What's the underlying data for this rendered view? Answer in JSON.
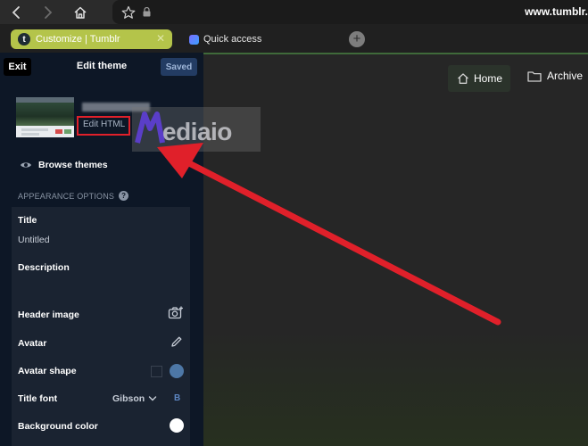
{
  "browser": {
    "url": "www.tumblr.",
    "tabs": [
      {
        "label": "Customize | Tumblr",
        "favicon": "t",
        "active": true
      },
      {
        "label": "Quick access",
        "active": false
      }
    ],
    "new_tab": "+"
  },
  "sidebar": {
    "exit_label": "Exit",
    "title": "Edit theme",
    "saved_label": "Saved",
    "edit_html_label": "Edit HTML",
    "browse_label": "Browse themes",
    "appearance_label": "APPEARANCE OPTIONS",
    "help": "?",
    "options": {
      "title_label": "Title",
      "title_value": "Untitled",
      "description_label": "Description",
      "header_image_label": "Header image",
      "avatar_label": "Avatar",
      "avatar_shape_label": "Avatar shape",
      "title_font_label": "Title font",
      "title_font_value": "Gibson",
      "title_font_bold": "B",
      "background_color_label": "Background color",
      "background_color_value": "#ffffff",
      "avatar_shape_color": "#4d77a6"
    }
  },
  "preview": {
    "nav": [
      {
        "label": "Home",
        "icon": "home-icon"
      },
      {
        "label": "Archive",
        "icon": "folder-icon"
      }
    ]
  },
  "overlay": {
    "watermark": "ediaio",
    "highlight_color": "#e0202a"
  }
}
